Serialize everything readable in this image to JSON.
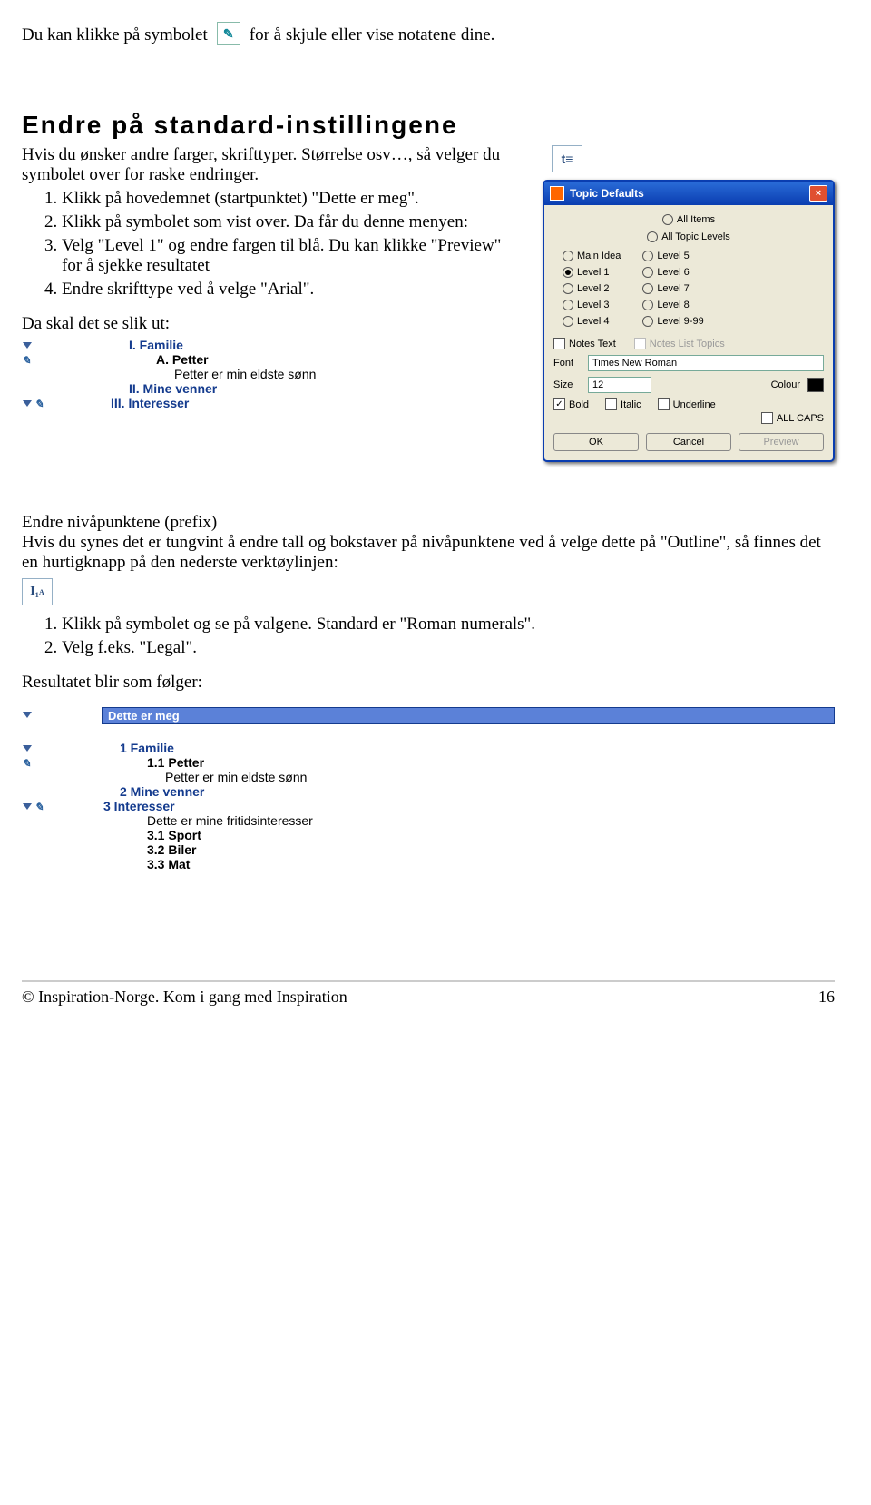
{
  "intro": {
    "before": "Du kan klikke på symbolet",
    "after": "for å skjule eller vise notatene dine."
  },
  "heading1": "Endre på standard-instillingene",
  "para1": "Hvis du ønsker andre farger, skrifttyper. Størrelse osv…, så velger du symbolet over for raske endringer.",
  "list1": {
    "i1": "Klikk på hovedemnet (startpunktet) \"Dette er meg\".",
    "i2": "Klikk på symbolet som vist over. Da får du denne menyen:",
    "i3": "Velg \"Level 1\" og endre fargen til blå. Du kan klikke \"Preview\" for å sjekke resultatet",
    "i4": "Endre skrifttype ved å velge \"Arial\"."
  },
  "resultline": "Da skal det se slik ut:",
  "dlg": {
    "title": "Topic Defaults",
    "allitems": "All Items",
    "alllevels": "All Topic Levels",
    "mainidea": "Main Idea",
    "l1": "Level 1",
    "l2": "Level 2",
    "l3": "Level 3",
    "l4": "Level 4",
    "l5": "Level 5",
    "l6": "Level 6",
    "l7": "Level 7",
    "l8": "Level 8",
    "l9": "Level 9-99",
    "notestext": "Notes Text",
    "noteslist": "Notes List Topics",
    "font_lbl": "Font",
    "font": "Times New Roman",
    "size_lbl": "Size",
    "size": "12",
    "colour": "Colour",
    "bold": "Bold",
    "italic": "Italic",
    "underline": "Underline",
    "allcaps": "ALL CAPS",
    "ok": "OK",
    "cancel": "Cancel",
    "preview": "Preview"
  },
  "ex1": {
    "r1": "I. Familie",
    "r2": "A. Petter",
    "r3": "Petter er min eldste sønn",
    "r4": "II. Mine venner",
    "r5": "III. Interesser"
  },
  "para2a": "Endre nivåpunktene (prefix)",
  "para2b": "Hvis du synes det er tungvint å endre tall og bokstaver på nivåpunktene ved å velge dette på \"Outline\", så finnes det en hurtigknapp på den nederste verktøylinjen:",
  "list2": {
    "i1": "Klikk på symbolet og se på valgene. Standard er \"Roman numerals\".",
    "i2": "Velg f.eks. \"Legal\"."
  },
  "para3": "Resultatet blir som følger:",
  "ex2": {
    "title": "Dette er meg",
    "r1": "1 Familie",
    "r2": "1.1 Petter",
    "r3": "Petter er min eldste sønn",
    "r4": "2 Mine venner",
    "r5": "3 Interesser",
    "r6": "Dette er mine fritidsinteresser",
    "r7": "3.1 Sport",
    "r8": "3.2 Biler",
    "r9": "3.3 Mat"
  },
  "footer": {
    "left": "© Inspiration-Norge. Kom i gang med Inspiration",
    "right": "16"
  }
}
